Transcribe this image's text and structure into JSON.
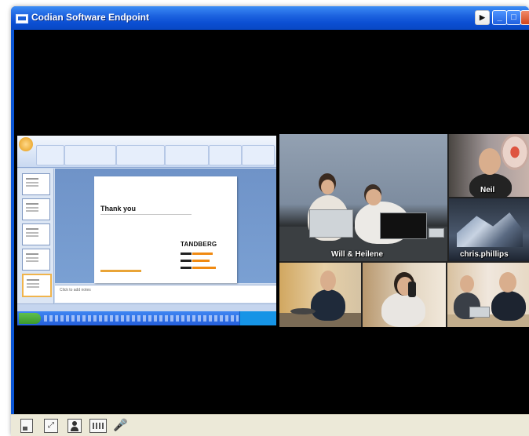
{
  "window": {
    "title": "Codian Software Endpoint",
    "controls": [
      "play-icon",
      "minimize-icon",
      "maximize-icon",
      "close-icon"
    ]
  },
  "presentation": {
    "slide_title": "Thank you",
    "brand": "TANDBERG",
    "notes_placeholder": "Click to add notes"
  },
  "video": {
    "participants": [
      {
        "label": "Will & Heilene"
      },
      {
        "label": "Neil"
      },
      {
        "label": "chris.phillips"
      }
    ]
  },
  "toolbar": {
    "icons": [
      "self-view-icon",
      "fullscreen-icon",
      "contacts-icon",
      "keypad-icon",
      "microphone-icon"
    ]
  },
  "colors": {
    "titlebar": "#0b4fd3",
    "video_background": "#000000",
    "toolbar": "#ece9d8"
  }
}
